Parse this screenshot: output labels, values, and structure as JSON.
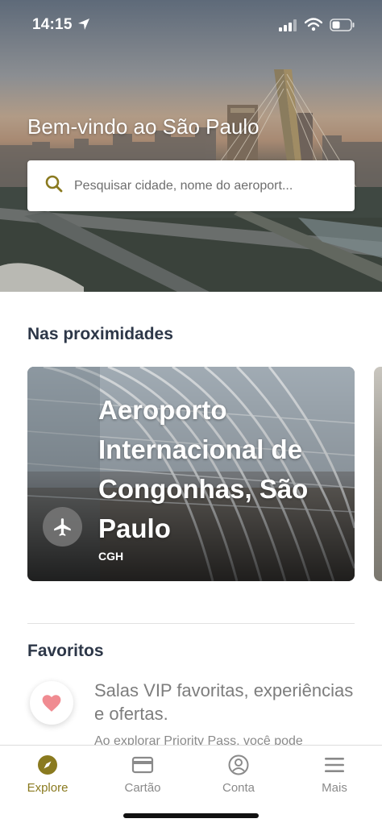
{
  "status_bar": {
    "time": "14:15",
    "location_icon": "location-arrow-icon",
    "signal_icon": "cellular-signal-icon",
    "wifi_icon": "wifi-icon",
    "battery_icon": "battery-icon"
  },
  "hero": {
    "welcome": "Bem-vindo ao São Paulo",
    "search_placeholder": "Pesquisar cidade, nome do aeroport...",
    "search_icon": "search-icon"
  },
  "nearby": {
    "title": "Nas proximidades",
    "cards": [
      {
        "title": "Aeroporto Internacional de Congonhas, São Paulo",
        "code": "CGH",
        "icon": "airplane-icon"
      }
    ]
  },
  "favorites": {
    "title": "Favoritos",
    "text": "Salas VIP favoritas, experiências e ofertas.",
    "subtext": "Ao explorar Priority Pass, você pode",
    "icon": "heart-icon"
  },
  "tabbar": {
    "tabs": [
      {
        "label": "Explore",
        "icon": "compass-icon",
        "active": true
      },
      {
        "label": "Cartão",
        "icon": "card-icon",
        "active": false
      },
      {
        "label": "Conta",
        "icon": "account-icon",
        "active": false
      },
      {
        "label": "Mais",
        "icon": "menu-icon",
        "active": false
      }
    ]
  },
  "colors": {
    "accent": "#8a7a1f",
    "heart": "#f08b91",
    "heading": "#2d3748"
  }
}
